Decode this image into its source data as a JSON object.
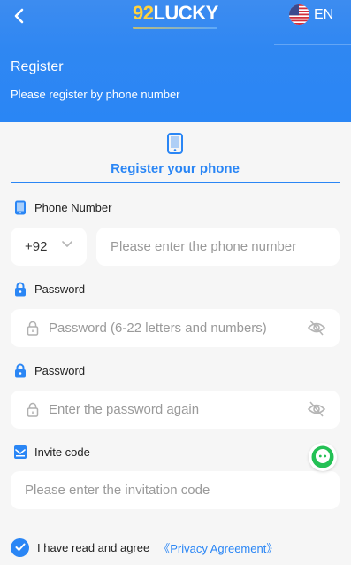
{
  "colors": {
    "primary": "#2a86f5",
    "logo_accent": "#ffd23f",
    "background": "#f6f6f6"
  },
  "header": {
    "back_icon": "chevron-left-icon",
    "logo_number": "92",
    "logo_word": "LUCKY",
    "language": {
      "flag_icon": "us-flag-icon",
      "label": "EN"
    },
    "title": "Register",
    "subtitle": "Please register by phone number"
  },
  "tab": {
    "icon": "phone-icon",
    "label": "Register your phone"
  },
  "phone": {
    "label": "Phone Number",
    "icon": "phone-icon",
    "country_code": "+92",
    "placeholder": "Please enter the phone number"
  },
  "password": {
    "label": "Password",
    "icon": "lock-icon",
    "placeholder": "Password (6-22 letters and numbers)"
  },
  "confirm_password": {
    "label": "Password",
    "icon": "lock-icon",
    "placeholder": "Enter the password again"
  },
  "invite": {
    "label": "Invite code",
    "icon": "invite-icon",
    "placeholder": "Please enter the invitation code"
  },
  "agreement": {
    "checked": true,
    "text": "I have read and agree",
    "link": "《Privacy Agreement》"
  },
  "chat_icon": "chat-icon"
}
